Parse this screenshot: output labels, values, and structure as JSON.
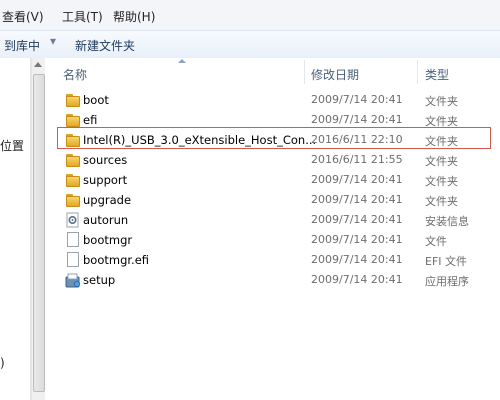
{
  "menubar": {
    "view": "查看(V)",
    "tools": "工具(T)",
    "help": "帮助(H)"
  },
  "toolbar": {
    "include_library": "到库中",
    "new_folder": "新建文件夹"
  },
  "leftpane": {
    "item1": "位置",
    "item2": ")"
  },
  "columns": {
    "name": "名称",
    "modified": "修改日期",
    "type": "类型"
  },
  "files": [
    {
      "name": "boot",
      "date": "2009/7/14 20:41",
      "type": "文件夹",
      "icon": "folder-icon"
    },
    {
      "name": "efi",
      "date": "2009/7/14 20:41",
      "type": "文件夹",
      "icon": "folder-icon"
    },
    {
      "name": "Intel(R)_USB_3.0_eXtensible_Host_Con...",
      "date": "2016/6/11 22:10",
      "type": "文件夹",
      "icon": "folder-icon"
    },
    {
      "name": "sources",
      "date": "2016/6/11 21:55",
      "type": "文件夹",
      "icon": "folder-icon"
    },
    {
      "name": "support",
      "date": "2009/7/14 20:41",
      "type": "文件夹",
      "icon": "folder-icon"
    },
    {
      "name": "upgrade",
      "date": "2009/7/14 20:41",
      "type": "文件夹",
      "icon": "folder-icon"
    },
    {
      "name": "autorun",
      "date": "2009/7/14 20:41",
      "type": "安装信息",
      "icon": "settings-file-icon"
    },
    {
      "name": "bootmgr",
      "date": "2009/7/14 20:41",
      "type": "文件",
      "icon": "file-icon"
    },
    {
      "name": "bootmgr.efi",
      "date": "2009/7/14 20:41",
      "type": "EFI 文件",
      "icon": "file-icon"
    },
    {
      "name": "setup",
      "date": "2009/7/14 20:41",
      "type": "应用程序",
      "icon": "setup-app-icon"
    }
  ],
  "highlight_color": "#d9574f"
}
